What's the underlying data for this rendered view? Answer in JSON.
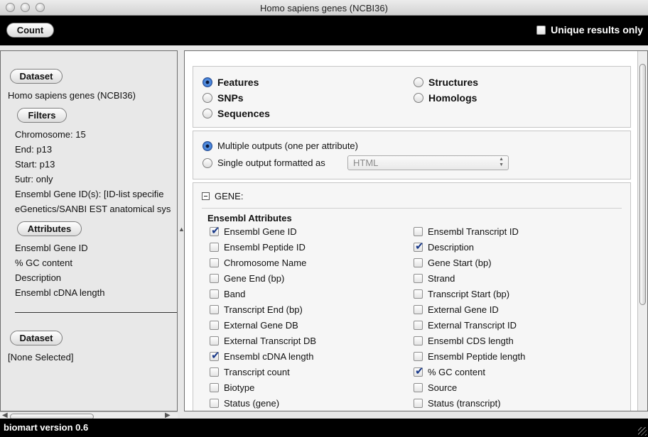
{
  "window": {
    "title": "Homo sapiens genes (NCBI36)"
  },
  "toolbar": {
    "count_label": "Count",
    "unique_label": "Unique results only",
    "unique_checked": false
  },
  "left": {
    "dataset_label": "Dataset",
    "dataset_name": "Homo sapiens genes (NCBI36)",
    "filters_label": "Filters",
    "filters": [
      "Chromosome: 15",
      "End: p13",
      "Start: p13",
      "5utr: only",
      "Ensembl Gene ID(s): [ID-list specifie",
      "eGenetics/SANBI EST anatomical sys"
    ],
    "attributes_label": "Attributes",
    "attributes": [
      "Ensembl Gene ID",
      "% GC content",
      "Description",
      "Ensembl cDNA length"
    ],
    "dataset2_label": "Dataset",
    "dataset2_name": "[None Selected]"
  },
  "page_types": {
    "features": "Features",
    "structures": "Structures",
    "snps": "SNPs",
    "homologs": "Homologs",
    "sequences": "Sequences",
    "selected": "Features"
  },
  "output": {
    "multiple": "Multiple outputs (one per attribute)",
    "single": "Single output formatted as",
    "format_value": "HTML",
    "selected": "multiple"
  },
  "gene": {
    "header": "GENE:",
    "section_title": "Ensembl Attributes",
    "left_items": [
      {
        "label": "Ensembl Gene ID",
        "checked": true
      },
      {
        "label": "Ensembl Peptide ID",
        "checked": false
      },
      {
        "label": "Chromosome Name",
        "checked": false
      },
      {
        "label": "Gene End (bp)",
        "checked": false
      },
      {
        "label": "Band",
        "checked": false
      },
      {
        "label": "Transcript End (bp)",
        "checked": false
      },
      {
        "label": "External Gene DB",
        "checked": false
      },
      {
        "label": "External Transcript DB",
        "checked": false
      },
      {
        "label": "Ensembl cDNA length",
        "checked": true
      },
      {
        "label": "Transcript count",
        "checked": false
      },
      {
        "label": "Biotype",
        "checked": false
      },
      {
        "label": "Status (gene)",
        "checked": false
      }
    ],
    "right_items": [
      {
        "label": "Ensembl Transcript ID",
        "checked": false
      },
      {
        "label": "Description",
        "checked": true
      },
      {
        "label": "Gene Start (bp)",
        "checked": false
      },
      {
        "label": "Strand",
        "checked": false
      },
      {
        "label": "Transcript Start (bp)",
        "checked": false
      },
      {
        "label": "External Gene ID",
        "checked": false
      },
      {
        "label": "External Transcript ID",
        "checked": false
      },
      {
        "label": "Ensembl CDS length",
        "checked": false
      },
      {
        "label": "Ensembl Peptide length",
        "checked": false
      },
      {
        "label": "% GC content",
        "checked": true
      },
      {
        "label": "Source",
        "checked": false
      },
      {
        "label": "Status (transcript)",
        "checked": false
      }
    ]
  },
  "statusbar": {
    "text": "biomart version 0.6"
  },
  "colors": {
    "toolbar_bg": "#000000",
    "accent_blue": "#2b67c9",
    "panel_bg": "#e8e8e8"
  },
  "icons": [
    "close-icon",
    "minimize-icon",
    "zoom-icon",
    "checkbox",
    "radio-button",
    "collapse-minus-icon",
    "resize-grip-icon"
  ]
}
